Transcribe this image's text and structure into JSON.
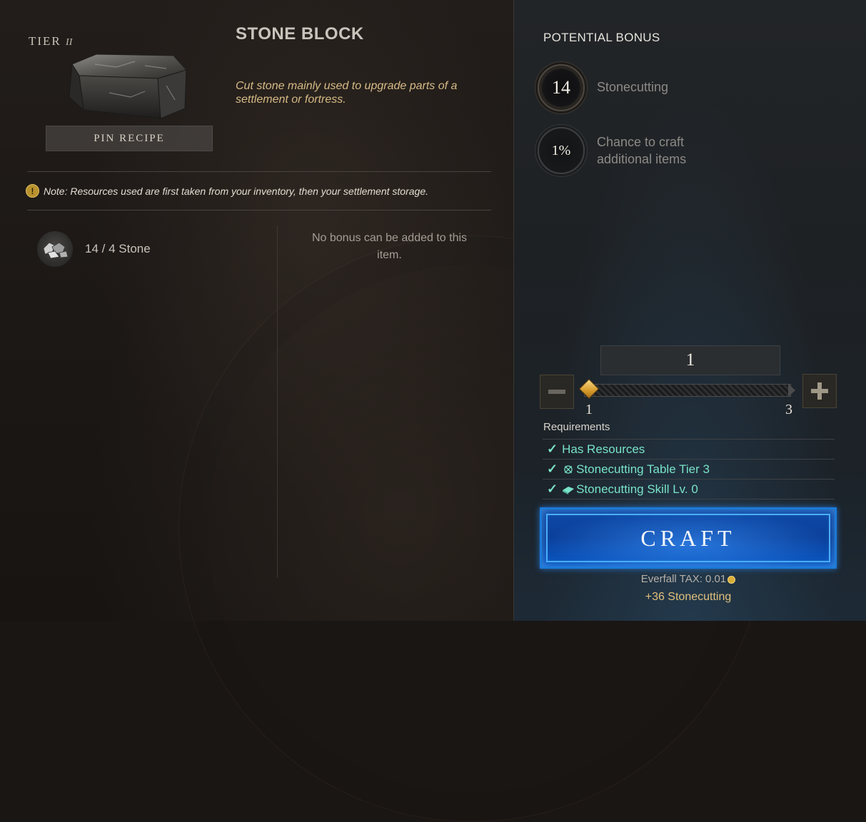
{
  "recipe": {
    "tier_label": "TIER",
    "tier_value": "II",
    "pin_label": "PIN RECIPE",
    "title": "STONE BLOCK",
    "description": "Cut stone mainly used to upgrade parts of a settlement or fortress.",
    "note": "Note: Resources used are first taken from your inventory, then your settlement storage.",
    "item_icon": "stone-block-icon"
  },
  "ingredients": [
    {
      "text": "14 / 4 Stone",
      "icon": "stone-icon"
    }
  ],
  "bonus_message": "No bonus can be added to this item.",
  "potential_bonus": {
    "title": "POTENTIAL BONUS",
    "skill_level": "14",
    "skill_name": "Stonecutting",
    "chance_value": "1%",
    "chance_label": "Chance to craft additional items"
  },
  "quantity": {
    "value": "1",
    "min_label": "1",
    "max_label": "3",
    "slider_fraction": 0
  },
  "requirements": {
    "title": "Requirements",
    "items": [
      {
        "text": "Has Resources",
        "met": true
      },
      {
        "text": "Stonecutting Table Tier 3",
        "met": true,
        "icon": "station-icon"
      },
      {
        "text": "Stonecutting Skill Lv. 0",
        "met": true,
        "icon": "skill-icon"
      }
    ]
  },
  "craft_label": "CRAFT",
  "tax_label": "Everfall TAX: 0.01",
  "xp_label": "+36 Stonecutting",
  "colors": {
    "accent_teal": "#78e3c8",
    "craft_blue": "#0f4aa7",
    "gold": "#e1c07b"
  }
}
